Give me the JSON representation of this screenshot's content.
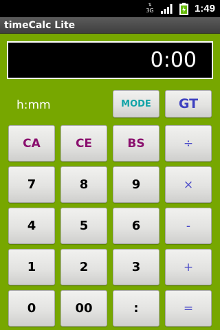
{
  "status": {
    "network": "3G",
    "time": "1:49"
  },
  "app": {
    "title": "timeCalc Lite"
  },
  "display": {
    "value": "0:00"
  },
  "format_label": "h:mm",
  "buttons": {
    "mode": "MODE",
    "gt": "GT",
    "ca": "CA",
    "ce": "CE",
    "bs": "BS",
    "divide": "÷",
    "seven": "7",
    "eight": "8",
    "nine": "9",
    "multiply": "×",
    "four": "4",
    "five": "5",
    "six": "6",
    "minus": "-",
    "one": "1",
    "two": "2",
    "three": "3",
    "plus": "+",
    "zero": "0",
    "double_zero": "00",
    "colon": ":",
    "equals": "="
  },
  "colors": {
    "background": "#77a700",
    "function_keys": "#8a0f6e",
    "operator_keys": "#4a4ac8",
    "mode_key": "#12a3a7"
  }
}
